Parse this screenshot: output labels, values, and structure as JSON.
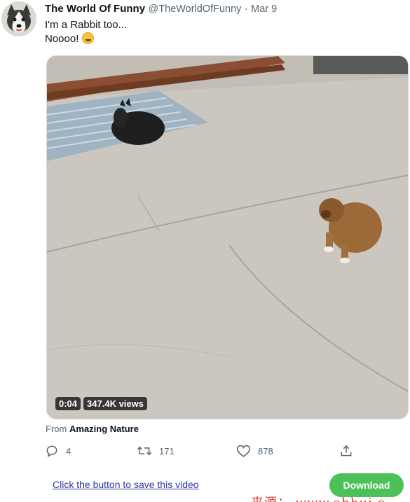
{
  "tweet": {
    "display_name": "The World Of Funny",
    "handle": "@TheWorldOfFunny",
    "separator": "·",
    "date": "Mar 9",
    "text_line1": "I'm a Rabbit too...",
    "text_line2": "Noooo!",
    "emoji": "rolling-on-floor-laughing-emoji"
  },
  "video": {
    "duration": "0:04",
    "views": "347.4K views"
  },
  "source": {
    "prefix": "From",
    "name": "Amazing Nature"
  },
  "actions": {
    "replies": "4",
    "retweets": "171",
    "likes": "878",
    "icons": [
      "reply-icon",
      "retweet-icon",
      "like-icon",
      "share-icon"
    ]
  },
  "download_bar": {
    "link_text": "Click the button to save this video",
    "button_label": "Download"
  },
  "watermark": {
    "text": "来源： www.ahhui.c"
  },
  "colors": {
    "download_green": "#4cc159",
    "link_blue": "#2d3a9e",
    "muted_text": "#536471",
    "watermark_red": "#d42a2a"
  }
}
